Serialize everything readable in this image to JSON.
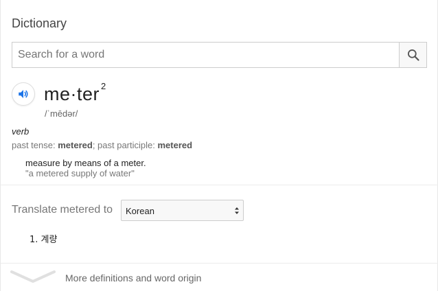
{
  "panel": {
    "title": "Dictionary"
  },
  "search": {
    "placeholder": "Search for a word",
    "value": ""
  },
  "entry": {
    "headword": "me·ter",
    "homograph": "2",
    "phonetic": "/ˈmēdər/",
    "part_of_speech": "verb",
    "past_tense_label": "past tense:",
    "past_tense": "metered",
    "past_participle_label": "; past participle:",
    "past_participle": "metered",
    "definition": "measure by means of a meter.",
    "example": "\"a metered supply of water\""
  },
  "translate": {
    "label": "Translate metered to",
    "selected_language": "Korean",
    "results": [
      {
        "number": "1.",
        "text": "계량"
      }
    ]
  },
  "footer": {
    "more_label": "More definitions and word origin"
  },
  "colors": {
    "speaker_blue": "#1a73e8",
    "chevron_gray": "#e0e0e0"
  }
}
